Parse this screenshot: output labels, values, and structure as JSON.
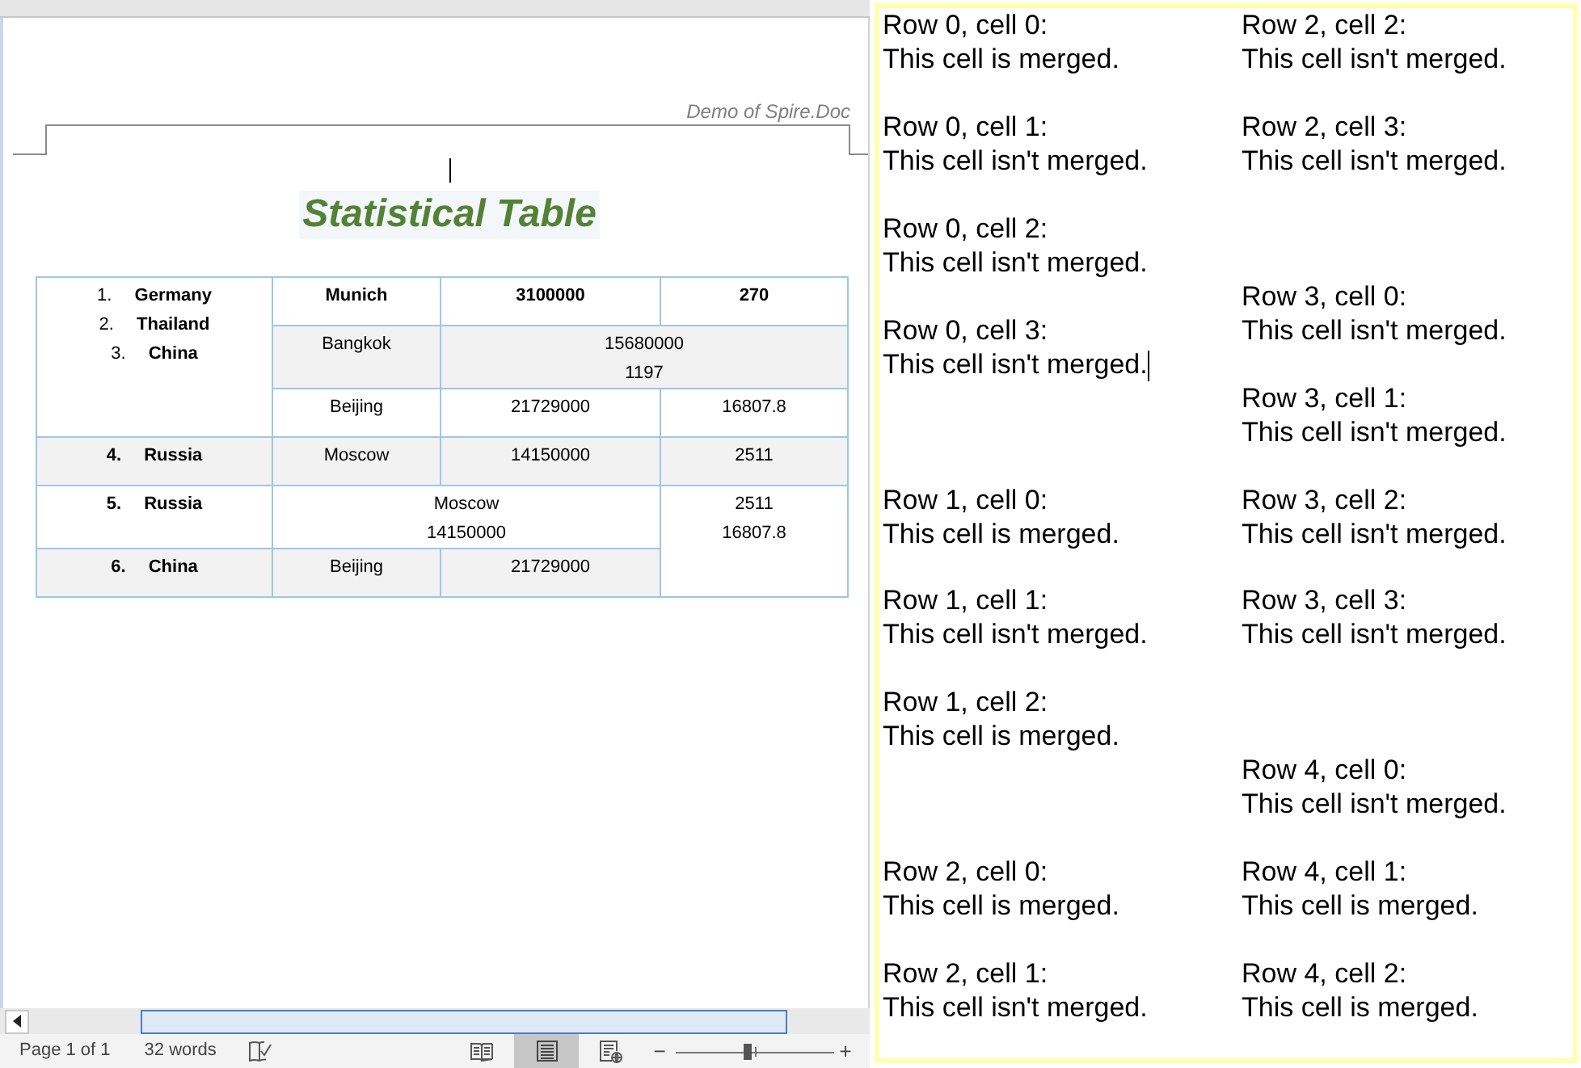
{
  "document": {
    "header": "Demo of Spire.Doc",
    "caret": true,
    "title": "Statistical Table",
    "table": {
      "rows": [
        {
          "shaded": false,
          "bold": true,
          "cells": [
            {
              "kind": "list",
              "rowspan": 3,
              "items": [
                {
                  "number": "1.",
                  "name": "Germany"
                },
                {
                  "number": "2.",
                  "name": "Thailand"
                },
                {
                  "number": "3.",
                  "name": "China"
                }
              ]
            },
            {
              "kind": "text",
              "lines": [
                "Munich"
              ]
            },
            {
              "kind": "text",
              "lines": [
                "3100000"
              ]
            },
            {
              "kind": "text",
              "lines": [
                "270"
              ]
            }
          ]
        },
        {
          "shaded": true,
          "bold": false,
          "cells": [
            {
              "kind": "text",
              "lines": [
                "Bangkok"
              ]
            },
            {
              "kind": "text",
              "colspan": 2,
              "lines": [
                "15680000",
                "1197"
              ]
            }
          ]
        },
        {
          "shaded": false,
          "bold": false,
          "cells": [
            {
              "kind": "text",
              "lines": [
                "Beijing"
              ]
            },
            {
              "kind": "text",
              "lines": [
                "21729000"
              ]
            },
            {
              "kind": "text",
              "lines": [
                "16807.8"
              ]
            }
          ]
        },
        {
          "shaded": true,
          "bold": false,
          "cells": [
            {
              "kind": "numbered",
              "number": "4.",
              "name": "Russia"
            },
            {
              "kind": "text",
              "lines": [
                "Moscow"
              ]
            },
            {
              "kind": "text",
              "lines": [
                "14150000"
              ]
            },
            {
              "kind": "text",
              "lines": [
                "2511"
              ]
            }
          ]
        },
        {
          "shaded": false,
          "bold": false,
          "cells": [
            {
              "kind": "numbered",
              "number": "5.",
              "name": "Russia"
            },
            {
              "kind": "text",
              "colspan": 2,
              "lines": [
                "Moscow",
                "14150000"
              ]
            },
            {
              "kind": "text",
              "rowspan": 2,
              "lines": [
                "2511",
                "16807.8"
              ]
            }
          ]
        },
        {
          "shaded": true,
          "bold": false,
          "cells": [
            {
              "kind": "numbered",
              "number": "6.",
              "name": "China"
            },
            {
              "kind": "text",
              "lines": [
                "Beijing"
              ]
            },
            {
              "kind": "text",
              "lines": [
                "21729000"
              ]
            }
          ]
        }
      ]
    }
  },
  "status_bar": {
    "page": "Page 1 of 1",
    "words": "32 words",
    "views": [
      {
        "kind": "read",
        "selected": false
      },
      {
        "kind": "print",
        "selected": true
      },
      {
        "kind": "web",
        "selected": false
      }
    ],
    "zoom": {
      "minus": "−",
      "plus": "+",
      "level": 0.45
    }
  },
  "output": {
    "groups": [
      {
        "entries": [
          {
            "label": "Row 0, cell 0:",
            "status": "This cell is merged.",
            "caret": false
          },
          {
            "label": "Row 0, cell 1:",
            "status": "This cell isn't merged.",
            "caret": false
          },
          {
            "label": "Row 0, cell 2:",
            "status": "This cell isn't merged.",
            "caret": false
          },
          {
            "label": "Row 0, cell 3:",
            "status": "This cell isn't merged.",
            "caret": true
          }
        ]
      },
      {
        "entries": [
          {
            "label": "Row 1, cell 0:",
            "status": "This cell is merged.",
            "caret": false
          },
          {
            "label": "Row 1, cell 1:",
            "status": "This cell isn't merged.",
            "caret": false
          },
          {
            "label": "Row 1, cell 2:",
            "status": "This cell is merged.",
            "caret": false
          }
        ]
      },
      {
        "entries": [
          {
            "label": "Row 2, cell 0:",
            "status": "This cell is merged.",
            "caret": false
          },
          {
            "label": "Row 2, cell 1:",
            "status": "This cell isn't merged.",
            "caret": false
          },
          {
            "label": "Row 2, cell 2:",
            "status": "This cell isn't merged.",
            "caret": false
          },
          {
            "label": "Row 2, cell 3:",
            "status": "This cell isn't merged.",
            "caret": false
          }
        ]
      },
      {
        "entries": [
          {
            "label": "Row 3, cell 0:",
            "status": "This cell isn't merged.",
            "caret": false
          },
          {
            "label": "Row 3, cell 1:",
            "status": "This cell isn't merged.",
            "caret": false
          },
          {
            "label": "Row 3, cell 2:",
            "status": "This cell isn't merged.",
            "caret": false
          },
          {
            "label": "Row 3, cell 3:",
            "status": "This cell isn't merged.",
            "caret": false
          }
        ]
      },
      {
        "entries": [
          {
            "label": "Row 4, cell 0:",
            "status": "This cell isn't merged.",
            "caret": false
          },
          {
            "label": "Row 4, cell 1:",
            "status": "This cell is merged.",
            "caret": false
          },
          {
            "label": "Row 4, cell 2:",
            "status": "This cell is merged.",
            "caret": false
          }
        ]
      }
    ]
  }
}
